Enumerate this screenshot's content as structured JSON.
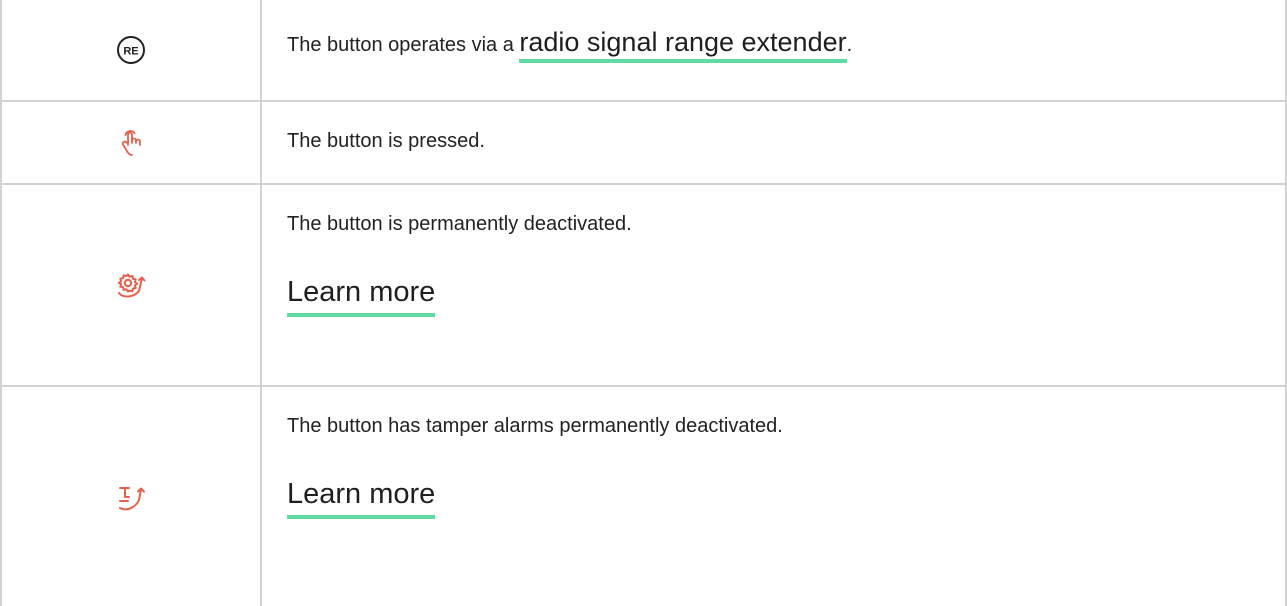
{
  "rows": [
    {
      "icon": "re-icon",
      "text_before": "The button operates via a ",
      "link": "radio signal range extender",
      "text_after": "."
    },
    {
      "icon": "hand-press-icon",
      "text": "The button is pressed."
    },
    {
      "icon": "gear-deactivated-icon",
      "text": "The button is permanently deactivated.",
      "link": "Learn more"
    },
    {
      "icon": "tamper-deactivated-icon",
      "text": "The button has tamper alarms permanently deactivated.",
      "link": "Learn more"
    }
  ],
  "icon_labels": {
    "re": "RE"
  },
  "colors": {
    "accent_underline": "#5edba3",
    "icon_red": "#e8604c",
    "border": "#d2d2d2"
  }
}
